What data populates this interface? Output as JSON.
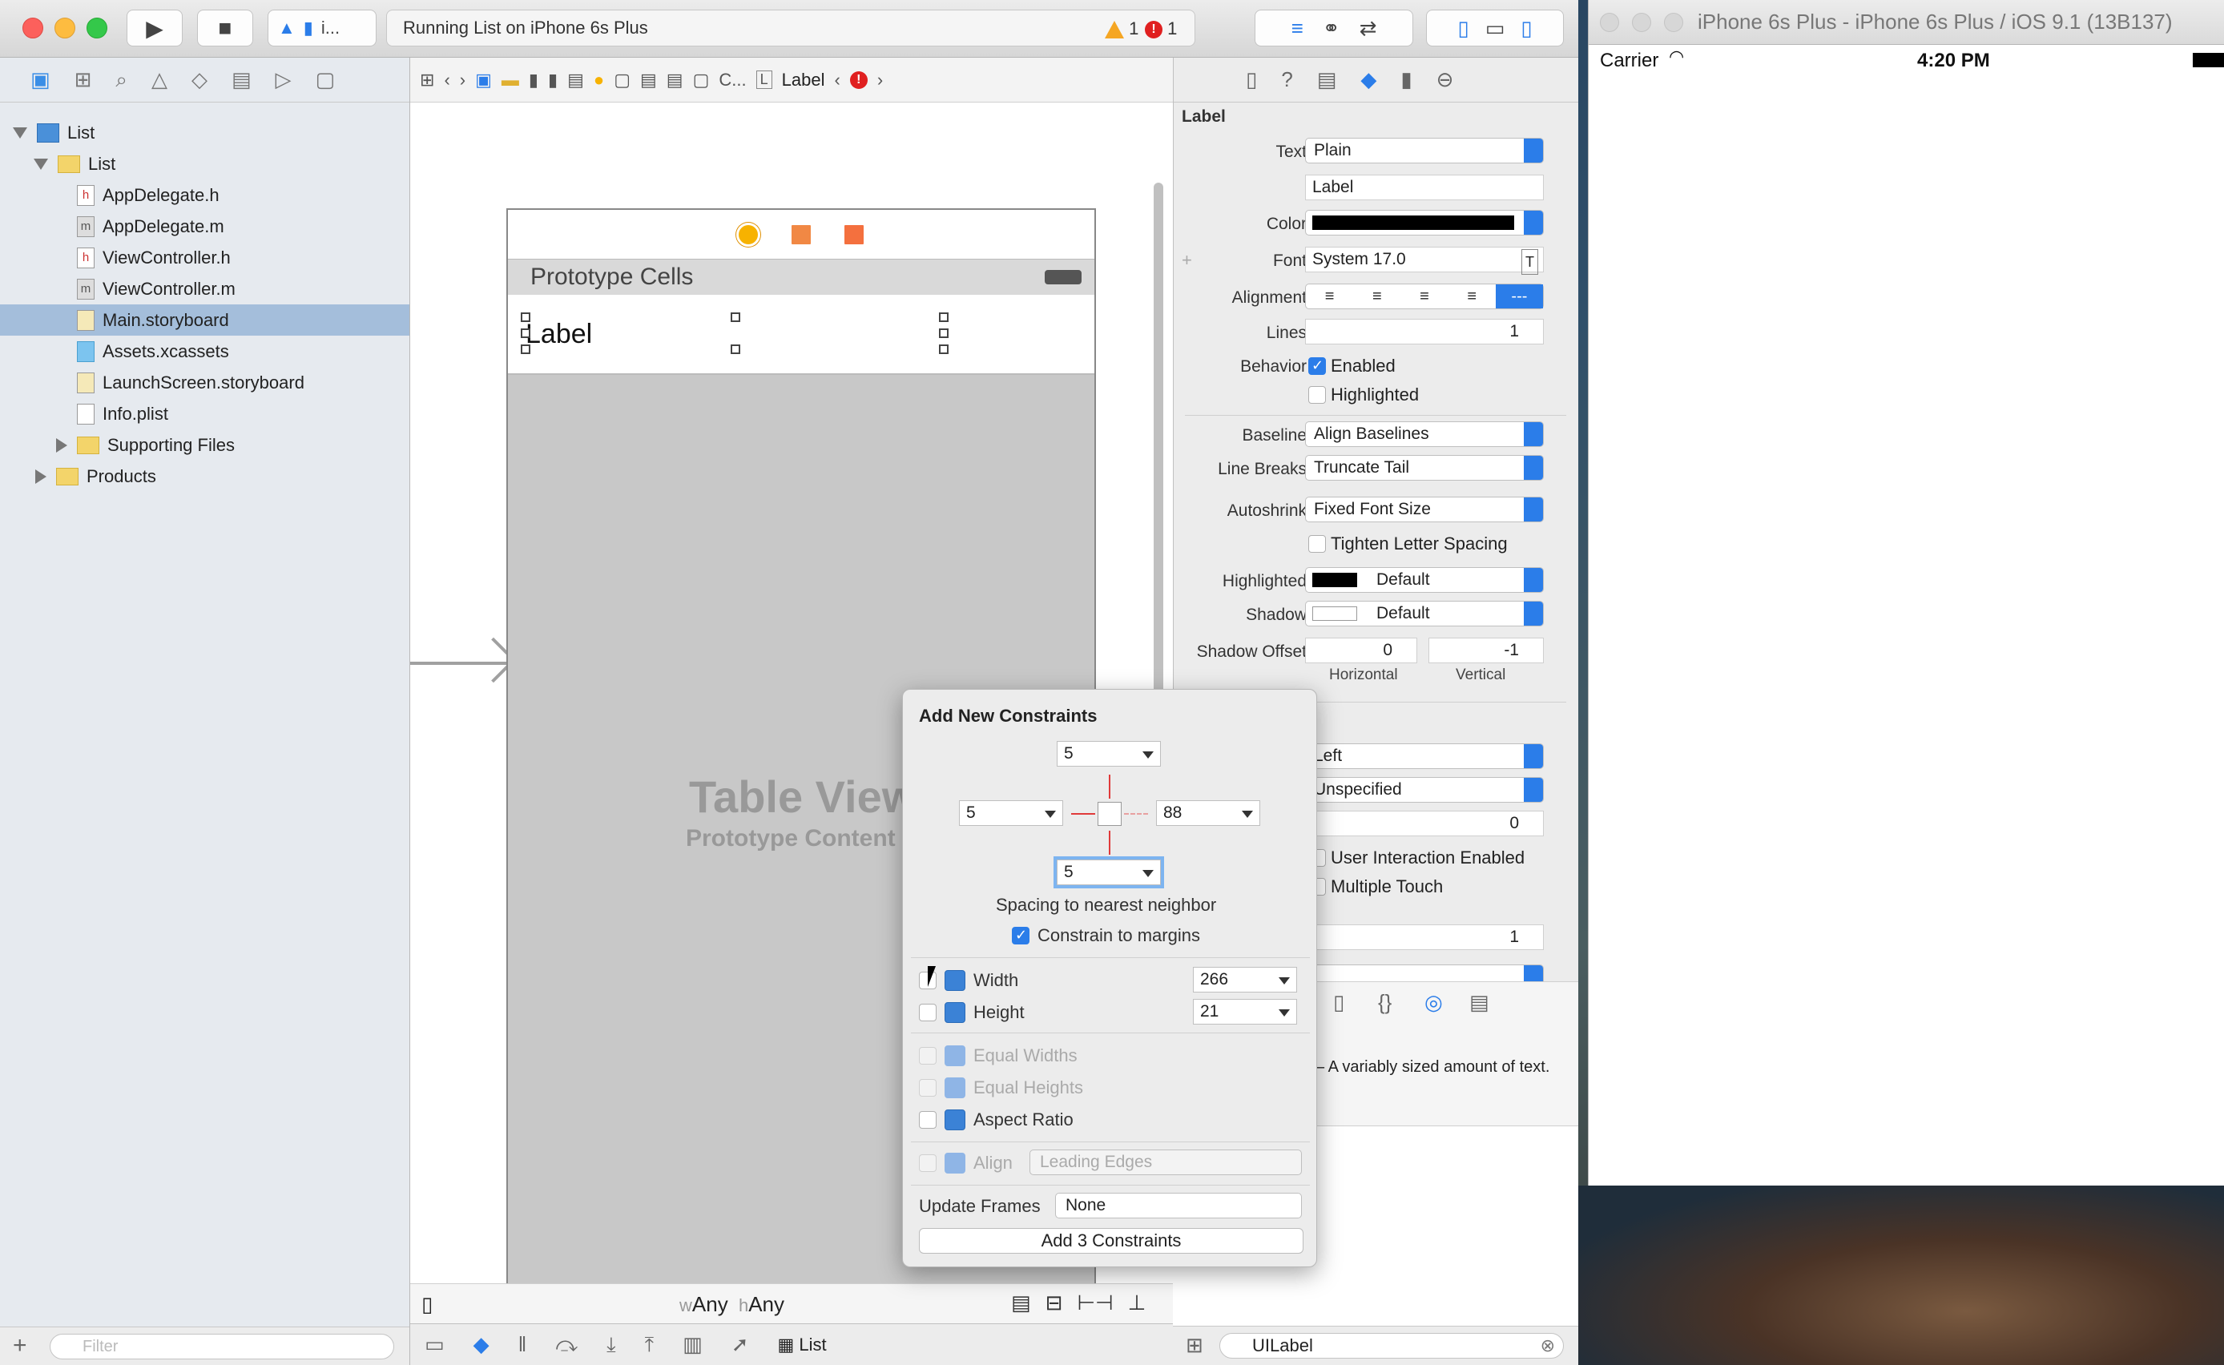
{
  "xcode": {
    "run_button": "▶",
    "stop_button": "■",
    "scheme": "i...",
    "activity_text": "Running List on iPhone 6s Plus",
    "warning_count": "1",
    "error_count": "1"
  },
  "navigator": {
    "items": [
      {
        "label": "List",
        "type": "project"
      },
      {
        "label": "List",
        "type": "folder"
      },
      {
        "label": "AppDelegate.h",
        "type": "h"
      },
      {
        "label": "AppDelegate.m",
        "type": "m"
      },
      {
        "label": "ViewController.h",
        "type": "h"
      },
      {
        "label": "ViewController.m",
        "type": "m"
      },
      {
        "label": "Main.storyboard",
        "type": "storyboard"
      },
      {
        "label": "Assets.xcassets",
        "type": "assets"
      },
      {
        "label": "LaunchScreen.storyboard",
        "type": "storyboard"
      },
      {
        "label": "Info.plist",
        "type": "plist"
      },
      {
        "label": "Supporting Files",
        "type": "folder"
      },
      {
        "label": "Products",
        "type": "folder"
      }
    ],
    "filter_placeholder": "Filter"
  },
  "jumpbar": {
    "crumb_last": "C...",
    "label_badge": "L",
    "label_text": "Label"
  },
  "canvas": {
    "prototype_cells": "Prototype Cells",
    "cell_label": "Label",
    "table_view_title": "Table View",
    "table_view_sub": "Prototype Content",
    "size_class_w": "Any",
    "size_class_h": "Any",
    "debug_target": "List"
  },
  "inspector": {
    "section": "Label",
    "text_label": "Text",
    "text_type": "Plain",
    "text_value": "Label",
    "color_label": "Color",
    "font_label": "Font",
    "font_value": "System 17.0",
    "alignment_label": "Alignment",
    "lines_label": "Lines",
    "lines_value": "1",
    "behavior_label": "Behavior",
    "enabled_label": "Enabled",
    "highlighted_chk_label": "Highlighted",
    "baseline_label": "Baseline",
    "baseline_value": "Align Baselines",
    "linebreaks_label": "Line Breaks",
    "linebreaks_value": "Truncate Tail",
    "autoshrink_label": "Autoshrink",
    "autoshrink_value": "Fixed Font Size",
    "tighten_label": "Tighten Letter Spacing",
    "highlighted_label": "Highlighted",
    "highlighted_value": "Default",
    "shadow_label": "Shadow",
    "shadow_value": "Default",
    "shadow_offset_label": "Shadow Offset",
    "shadow_h": "0",
    "shadow_v": "-1",
    "horizontal_label": "Horizontal",
    "vertical_label": "Vertical",
    "mode_value": "Left",
    "semantic_value": "Unspecified",
    "tag_value": "0",
    "user_interaction": "User Interaction Enabled",
    "multiple_touch": "Multiple Touch",
    "alpha_value": "1",
    "lib_desc": "– A variably sized amount of text.",
    "lib_filter": "UILabel"
  },
  "popover": {
    "title": "Add New Constraints",
    "top_value": "5",
    "left_value": "5",
    "right_value": "88",
    "bottom_value": "5",
    "spacing_caption": "Spacing to nearest neighbor",
    "constrain_margins": "Constrain to margins",
    "width_label": "Width",
    "width_value": "266",
    "height_label": "Height",
    "height_value": "21",
    "equal_widths": "Equal Widths",
    "equal_heights": "Equal Heights",
    "aspect_ratio": "Aspect Ratio",
    "align_label": "Align",
    "align_value": "Leading Edges",
    "update_frames_label": "Update Frames",
    "update_frames_value": "None",
    "add_button": "Add 3 Constraints"
  },
  "simulator": {
    "title": "iPhone 6s Plus - iPhone 6s Plus / iOS 9.1 (13B137)",
    "carrier": "Carrier",
    "time": "4:20 PM"
  },
  "colors": {
    "accent": "#2b7de9",
    "selection": "#a4bedb",
    "constraint_red": "#e03a3a"
  }
}
